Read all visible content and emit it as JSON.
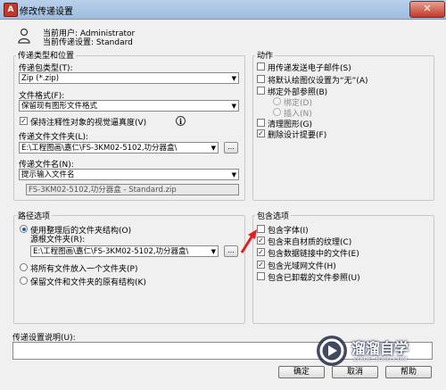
{
  "window": {
    "title": "修改传递设置",
    "close_glyph": "✕"
  },
  "header": {
    "current_user": "当前用户: Administrator",
    "current_setting": "当前传递设置: Standard"
  },
  "transmittal_type": {
    "group_label": "传递类型和位置",
    "package_type_label": "传递包类型(T):",
    "package_type_value": "Zip (*.zip)",
    "file_format_label": "文件格式(F):",
    "file_format_value": "保留现有图形文件格式",
    "keep_scale_label": "保持注释性对象的视觉逼真度(V)",
    "keep_scale_checked": true,
    "folder_label": "传递文件文件夹(L):",
    "folder_value": "E:\\工程图画\\嘉仁\\FS-3KM02-5102,功分器盒\\",
    "browse_label": "...",
    "filename_label": "传递文件名(N):",
    "filename_value": "提示输入文件名",
    "filename_preview": "FS-3KM02-5102,功分器盒 - Standard.zip"
  },
  "path_options": {
    "group_label": "路径选项",
    "option1_label": "使用整理后的文件夹结构(O)",
    "option1_selected": true,
    "source_root_label": "源根文件夹(R):",
    "source_root_value": "E:\\工程图画\\嘉仁\\FS-3KM02-5102,功分器盒\\",
    "browse_label": "...",
    "option2_label": "将所有文件放入一个文件夹(P)",
    "option3_label": "保留文件和文件夹的原有结构(K)"
  },
  "actions": {
    "group_label": "动作",
    "email_label": "用传递发送电子邮件(S)",
    "plotter_label": "将默认绘图仪设置为“无”(A)",
    "bind_xref_label": "绑定外部参照(B)",
    "bind_label": "绑定(D)",
    "insert_label": "插入(N)",
    "purge_label": "清理图形(G)",
    "remove_signature_label": "删除设计提要(F)",
    "remove_signature_checked": true
  },
  "include_options": {
    "group_label": "包含选项",
    "fonts_label": "包含字体(I)",
    "fonts_checked": false,
    "textures_label": "包含来自材质的纹理(C)",
    "textures_checked": true,
    "data_links_label": "包含数据链接中的文件(E)",
    "data_links_checked": true,
    "photometric_label": "包含光域网文件(H)",
    "photometric_checked": true,
    "unloaded_xref_label": "包含已卸载的文件参照(U)",
    "unloaded_xref_checked": false
  },
  "description": {
    "label": "传递设置说明(U):",
    "value": ""
  },
  "buttons": {
    "ok": "确定",
    "cancel": "取消",
    "help": "帮助"
  },
  "watermark": {
    "name": "溜溜自学",
    "url": "ZIXUE.3D66.COM"
  },
  "colors": {
    "title_bar": "#9fbde0",
    "close": "#c0392b",
    "accent": "#1f5fa8",
    "arrow": "#e02020",
    "watermark_bg": "#1f2a44"
  }
}
